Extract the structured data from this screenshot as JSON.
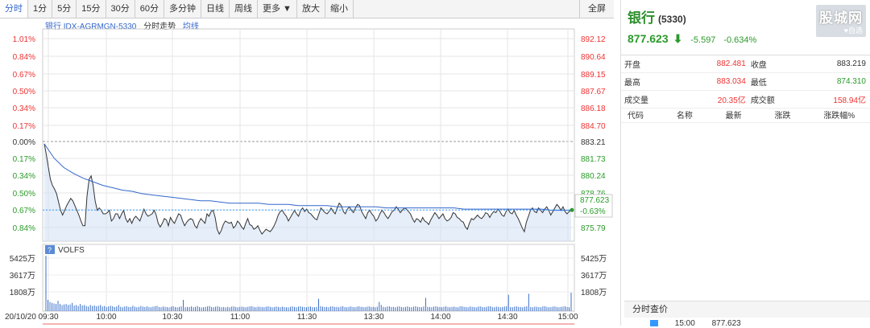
{
  "toolbar": {
    "items": [
      "分时",
      "1分",
      "5分",
      "15分",
      "30分",
      "60分",
      "多分钟",
      "日线",
      "周线",
      "更多 ▼",
      "放大",
      "缩小"
    ],
    "fullscreen": "全屏"
  },
  "chart_label": {
    "name": "银行 IDX-AGRMGN-5330",
    "trend": "分时走势",
    "avg": "均线"
  },
  "volume_label": "VOLFS",
  "quote": {
    "name": "银行",
    "code": "(5330)",
    "price": "877.623",
    "change": "-5.597",
    "pct": "-0.634%",
    "rows": [
      {
        "l1": "开盘",
        "v1": "882.481",
        "l2": "收盘",
        "v2": "883.219"
      },
      {
        "l1": "最高",
        "v1": "883.034",
        "l2": "最低",
        "v2": "874.310"
      },
      {
        "l1": "成交量",
        "v1": "20.35亿",
        "l2": "成交额",
        "v2": "158.94亿"
      }
    ],
    "list_headers": [
      "代码",
      "名称",
      "最新",
      "涨跌",
      "涨跌幅%"
    ],
    "section_title": "分时查价",
    "tick": {
      "time": "15:00",
      "price": "877.623"
    }
  },
  "logo": {
    "text": "股城网",
    "tag": "自选"
  },
  "chart_data": {
    "type": "line",
    "date_label": "20/10/20",
    "x_ticks": [
      "09:30",
      "10:00",
      "10:30",
      "11:00",
      "11:30",
      "13:30",
      "14:00",
      "14:30",
      "15:00"
    ],
    "price_axis": [
      "892.12",
      "890.64",
      "889.15",
      "887.67",
      "886.18",
      "884.70",
      "883.21",
      "881.73",
      "880.24",
      "878.76",
      "877.623",
      "875.79"
    ],
    "pct_axis": [
      "1.01%",
      "0.84%",
      "0.67%",
      "0.50%",
      "0.34%",
      "0.17%",
      "0.00%",
      "0.17%",
      "0.34%",
      "0.50%",
      "0.67%",
      "0.84%"
    ],
    "last_price": "877.623",
    "last_pct": "-0.63%",
    "ylim": [
      875.0,
      892.6
    ],
    "baseline": 883.21,
    "volume_axis": [
      "5425万",
      "3617万",
      "1808万"
    ],
    "price_series": [
      883.2,
      882.3,
      881.2,
      880.2,
      879.7,
      879.4,
      879.0,
      878.3,
      877.6,
      877.2,
      877.6,
      878.0,
      878.3,
      878.6,
      878.4,
      878.0,
      877.6,
      877.2,
      876.7,
      876.3,
      876.3,
      878.8,
      880.2,
      880.5,
      879.7,
      878.4,
      877.6,
      877.8,
      877.6,
      877.3,
      877.3,
      877.4,
      877.6,
      876.7,
      876.9,
      877.3,
      877.3,
      876.9,
      877.3,
      877.6,
      876.9,
      876.6,
      876.9,
      876.5,
      876.9,
      877.1,
      876.9,
      876.7,
      877.2,
      877.7,
      877.3,
      877.1,
      877.2,
      877.3,
      877.6,
      877.2,
      876.5,
      876.2,
      876.5,
      876.9,
      876.8,
      876.3,
      877.0,
      876.7,
      876.5,
      876.9,
      877.3,
      877.2,
      876.7,
      876.3,
      876.6,
      876.8,
      876.9,
      876.8,
      876.3,
      876.1,
      876.6,
      876.9,
      876.7,
      876.5,
      877.3,
      877.1,
      877.5,
      877.6,
      877.0,
      876.0,
      875.6,
      875.9,
      876.4,
      876.7,
      876.6,
      876.5,
      876.6,
      876.1,
      876.3,
      876.7,
      876.5,
      876.2,
      876.0,
      876.5,
      876.9,
      876.4,
      876.3,
      876.0,
      876.1,
      876.3,
      875.9,
      875.6,
      875.8,
      876.0,
      875.9,
      875.8,
      876.0,
      876.3,
      876.7,
      877.2,
      877.5,
      877.6,
      877.3,
      877.1,
      876.7,
      877.0,
      877.3,
      877.6,
      877.3,
      877.1,
      877.6,
      877.8,
      877.5,
      877.7,
      877.4,
      877.3,
      877.1,
      876.9,
      876.8,
      877.3,
      877.8,
      877.6,
      877.4,
      877.3,
      877.5,
      877.8,
      877.5,
      877.3,
      877.8,
      878.2,
      878.0,
      877.5,
      877.3,
      877.7,
      877.9,
      877.6,
      877.4,
      877.8,
      878.1,
      878.0,
      877.5,
      877.2,
      876.9,
      877.4,
      877.6,
      877.3,
      877.1,
      876.7,
      876.9,
      877.3,
      877.6,
      877.4,
      877.1,
      876.9,
      877.2,
      877.5,
      877.6,
      877.9,
      877.7,
      877.4,
      877.6,
      877.8,
      877.7,
      877.5,
      877.3,
      876.9,
      876.6,
      876.9,
      876.8,
      876.6,
      877.0,
      876.7,
      876.6,
      876.4,
      876.8,
      877.1,
      877.4,
      877.2,
      876.9,
      877.1,
      877.3,
      876.9,
      876.7,
      876.8,
      877.0,
      877.4,
      877.3,
      877.0,
      876.9,
      876.7,
      876.6,
      876.2,
      876.0,
      876.5,
      876.9,
      876.8,
      877.0,
      877.2,
      877.0,
      876.9,
      877.1,
      877.4,
      877.3,
      877.0,
      877.3,
      877.5,
      877.4,
      877.7,
      877.5,
      877.2,
      877.1,
      877.5,
      877.7,
      877.4,
      877.3,
      877.6,
      877.2,
      876.9,
      876.5,
      876.1,
      875.8,
      876.6,
      877.1,
      877.6,
      877.8,
      877.5,
      877.4,
      877.8,
      877.6,
      877.4,
      877.7,
      877.9,
      877.6,
      877.2,
      877.5,
      877.8,
      878.1,
      877.9,
      877.6,
      877.9,
      877.5,
      877.3,
      877.5,
      877.6
    ],
    "avg_series": [
      883.2,
      882.0,
      881.2,
      880.7,
      880.3,
      880.0,
      879.7,
      879.5,
      879.3,
      879.2,
      879.0,
      878.9,
      878.8,
      878.7,
      878.6,
      878.5,
      878.4,
      878.4,
      878.3,
      878.2,
      878.2,
      878.2,
      878.2,
      878.1,
      878.1,
      878.1,
      878.0,
      878.0,
      878.0,
      878.0,
      877.9,
      877.9,
      877.9,
      877.9,
      877.9,
      877.8,
      877.8,
      877.8,
      877.8,
      877.8,
      877.8,
      877.8,
      877.8,
      877.7,
      877.7,
      877.7,
      877.7,
      877.7,
      877.7,
      877.7,
      877.7,
      877.7,
      877.6,
      877.6,
      877.6
    ],
    "volume": [
      5425,
      1100,
      900,
      800,
      750,
      700,
      1000,
      700,
      600,
      650,
      700,
      600,
      650,
      800,
      550,
      600,
      500,
      700,
      550,
      600,
      500,
      450,
      600,
      500,
      550,
      480,
      520,
      600,
      450,
      500,
      400,
      460,
      520,
      480,
      400,
      450,
      600,
      420,
      380,
      450,
      480,
      420,
      400,
      520,
      430,
      380,
      420,
      500,
      440,
      390,
      460,
      400,
      380,
      430,
      480,
      520,
      400,
      380,
      450,
      420,
      390,
      360,
      440,
      480,
      400,
      380,
      420,
      460,
      1100,
      380,
      420,
      400,
      460,
      380,
      420,
      500,
      400,
      360,
      380,
      420,
      460,
      500,
      400,
      380,
      440,
      480,
      420,
      380,
      400,
      360,
      420,
      380,
      440,
      460,
      400,
      380,
      420,
      440,
      400,
      380,
      420,
      460,
      480,
      400,
      380,
      440,
      420,
      400,
      380,
      430,
      470,
      420,
      380,
      400,
      450,
      420,
      380,
      440,
      400,
      380,
      360,
      420,
      460,
      400,
      380,
      440,
      480,
      420,
      400,
      380,
      430,
      450,
      400,
      380,
      420,
      1200,
      480,
      440,
      400,
      420,
      380,
      450,
      470,
      400,
      420,
      380,
      440,
      480,
      400,
      380,
      420,
      450,
      400,
      380,
      440,
      480,
      420,
      400,
      380,
      430,
      460,
      400,
      420,
      380,
      440,
      900,
      600,
      420,
      380,
      450,
      480,
      400,
      420,
      380,
      440,
      460,
      400,
      380,
      420,
      460,
      400,
      380,
      440,
      480,
      420,
      400,
      380,
      450,
      1300,
      420,
      400,
      380,
      440,
      480,
      420,
      400,
      380,
      430,
      460,
      400,
      380,
      420,
      440,
      400,
      380,
      460,
      480,
      420,
      400,
      380,
      450,
      420,
      400,
      380,
      440,
      460,
      400,
      380,
      420,
      460,
      480,
      400,
      380,
      440,
      420,
      380,
      400,
      450,
      470,
      1600,
      400,
      380,
      440,
      460,
      420,
      400,
      380,
      430,
      470,
      1700,
      400,
      380,
      440,
      420,
      400,
      380,
      460,
      480,
      420,
      380,
      400,
      440,
      460,
      400,
      380,
      420,
      450,
      480,
      400,
      380,
      1800
    ]
  }
}
